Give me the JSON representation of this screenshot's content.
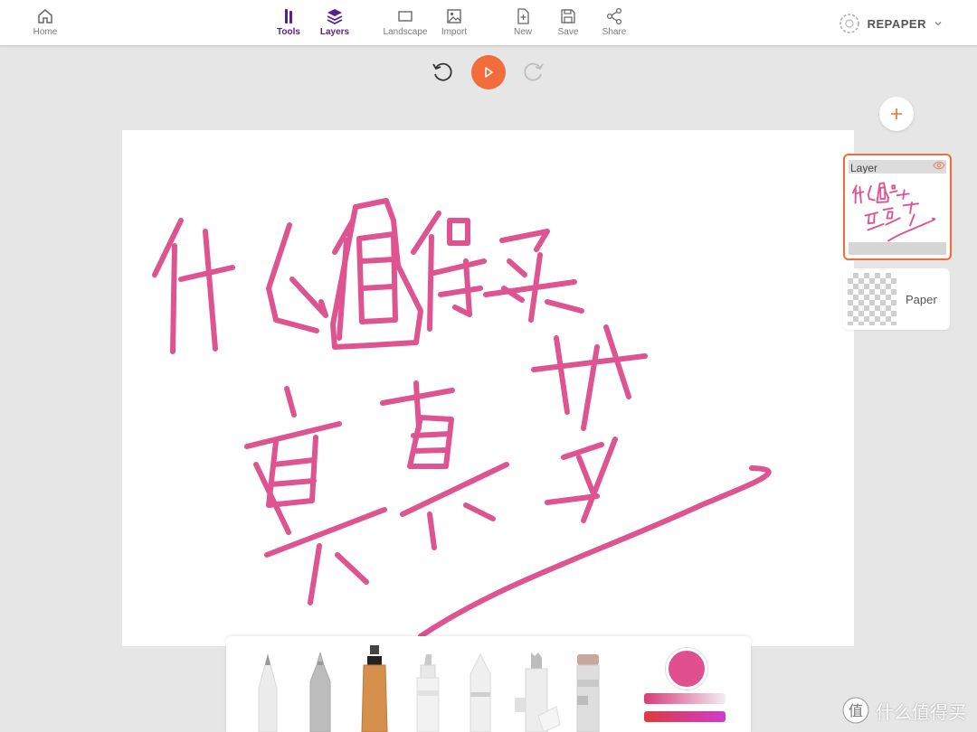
{
  "toolbar": {
    "home": "Home",
    "tools": "Tools",
    "layers": "Layers",
    "landscape": "Landscape",
    "import": "Import",
    "new": "New",
    "save": "Save",
    "share": "Share"
  },
  "brand": {
    "name": "REPAPER"
  },
  "controls": {
    "undo_icon": "undo-icon",
    "play_icon": "play-icon",
    "redo_icon": "redo-icon"
  },
  "colors": {
    "accent": "#f26c3c",
    "ink": "#e04f8e",
    "active_nav": "#5a1f8a"
  },
  "layers": [
    {
      "name": "Layer",
      "selected": true,
      "visible": true
    },
    {
      "name": "Paper",
      "selected": false
    }
  ],
  "tools": [
    "pencil",
    "fine-liner",
    "marker",
    "highlighter",
    "crayon",
    "fountain-pen",
    "eraser"
  ],
  "brush": {
    "color": "#e04f8e"
  },
  "watermark": {
    "text": "什么值得买"
  }
}
